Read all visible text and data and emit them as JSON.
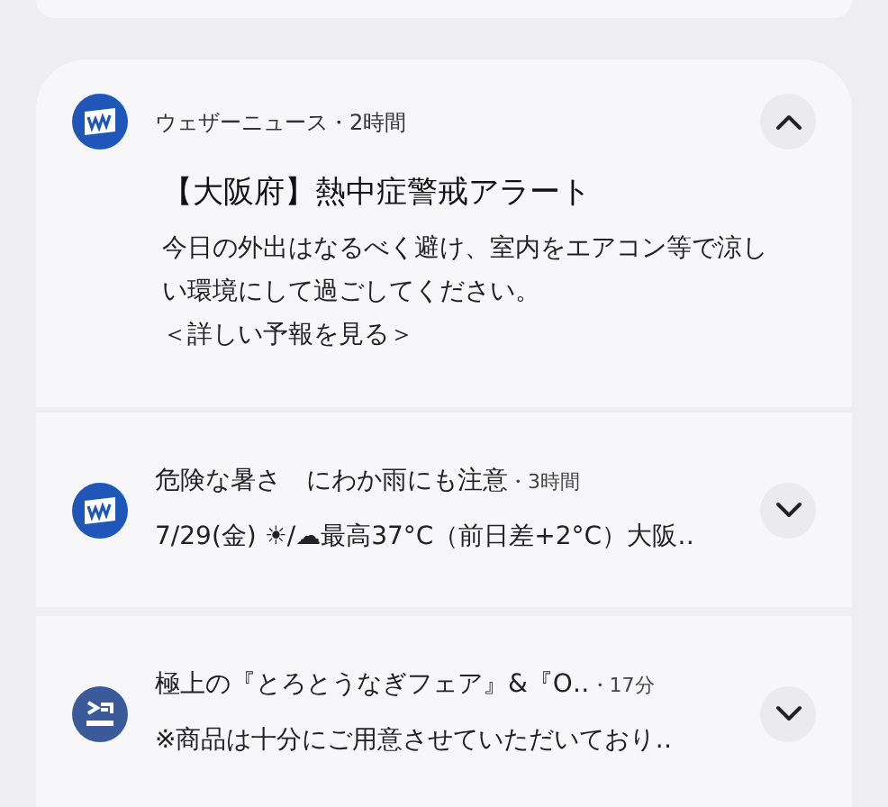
{
  "notifications": [
    {
      "kind": "weather",
      "expanded": true,
      "app_name": "ウェザーニュース",
      "time": "・2時間",
      "title": "【大阪府】熱中症警戒アラート",
      "body": "今日の外出はなるべく避け、室内をエアコン等で涼しい環境にして過ごしてください。",
      "link": "＜詳しい予報を見る＞"
    },
    {
      "kind": "weather",
      "expanded": false,
      "title": "危険な暑さ　にわか雨にも注意",
      "time": "・3時間",
      "body": "7/29(金) ☀/☁最高37°C（前日差+2°C）大阪‥"
    },
    {
      "kind": "sushi",
      "expanded": false,
      "title": "極上の『とろとうなぎフェア』&『O‥",
      "time": "・17分",
      "body": "※商品は十分にご用意させていただいており‥"
    }
  ]
}
